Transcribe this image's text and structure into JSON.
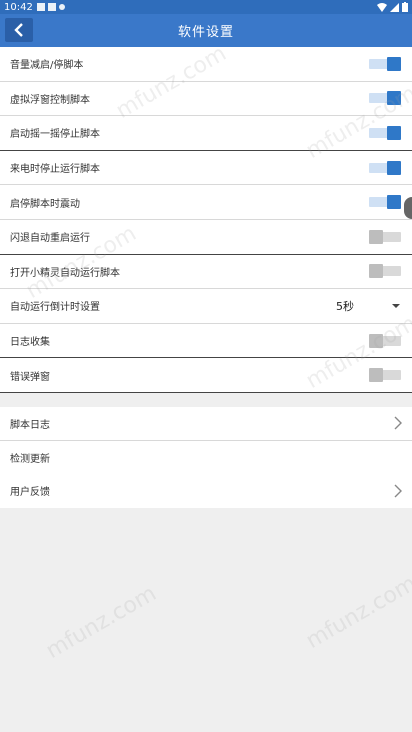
{
  "status_bar": {
    "time": "10:42"
  },
  "app_bar": {
    "title": "软件设置",
    "back_icon": "chevron-left-icon"
  },
  "settings_toggles": [
    {
      "label": "音量减启/停脚本",
      "on": true
    },
    {
      "label": "虚拟浮窗控制脚本",
      "on": true
    },
    {
      "label": "启动摇一摇停止脚本",
      "on": true
    },
    {
      "label": "来电时停止运行脚本",
      "on": true
    },
    {
      "label": "启停脚本时震动",
      "on": true
    },
    {
      "label": "闪退自动重启运行",
      "on": false
    },
    {
      "label": "打开小精灵自动运行脚本",
      "on": false
    }
  ],
  "countdown_setting": {
    "label": "自动运行倒计时设置",
    "value": "5秒"
  },
  "more_toggles": [
    {
      "label": "日志收集",
      "on": false
    },
    {
      "label": "错误弹窗",
      "on": false
    }
  ],
  "links": [
    {
      "label": "脚本日志",
      "chevron": true
    },
    {
      "label": "检测更新",
      "chevron": false
    },
    {
      "label": "用户反馈",
      "chevron": true
    }
  ],
  "watermark_text": "mfunz.com",
  "colors": {
    "accent": "#3a78c9",
    "toggle_on": "#2f78c8",
    "toggle_off": "#bdbdbd"
  }
}
